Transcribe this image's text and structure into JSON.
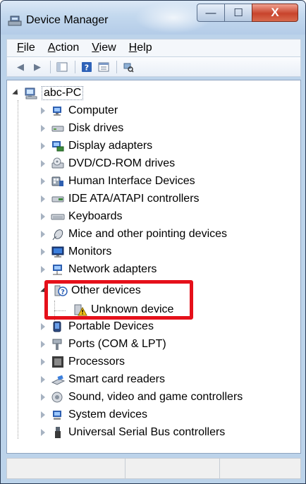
{
  "window": {
    "title": "Device Manager",
    "controls": {
      "minimize": "—",
      "maximize": "☐",
      "close": "X"
    }
  },
  "menu": {
    "items": [
      {
        "hotkey": "F",
        "rest": "ile"
      },
      {
        "hotkey": "A",
        "rest": "ction"
      },
      {
        "hotkey": "V",
        "rest": "iew"
      },
      {
        "hotkey": "H",
        "rest": "elp"
      }
    ]
  },
  "toolbar": {
    "back": "◀",
    "forward": "▶"
  },
  "tree": {
    "root": "abc-PC",
    "items": [
      {
        "label": "Computer",
        "icon": "computer-icon"
      },
      {
        "label": "Disk drives",
        "icon": "disk-drive-icon"
      },
      {
        "label": "Display adapters",
        "icon": "display-adapter-icon"
      },
      {
        "label": "DVD/CD-ROM drives",
        "icon": "dvd-drive-icon"
      },
      {
        "label": "Human Interface Devices",
        "icon": "hid-icon"
      },
      {
        "label": "IDE ATA/ATAPI controllers",
        "icon": "ide-controller-icon"
      },
      {
        "label": "Keyboards",
        "icon": "keyboard-icon"
      },
      {
        "label": "Mice and other pointing devices",
        "icon": "mouse-icon"
      },
      {
        "label": "Monitors",
        "icon": "monitor-icon"
      },
      {
        "label": "Network adapters",
        "icon": "network-adapter-icon"
      },
      {
        "label": "Other devices",
        "icon": "other-devices-icon",
        "children": [
          {
            "label": "Unknown device",
            "icon": "unknown-device-warning-icon"
          }
        ]
      },
      {
        "label": "Portable Devices",
        "icon": "portable-device-icon"
      },
      {
        "label": "Ports (COM & LPT)",
        "icon": "port-icon"
      },
      {
        "label": "Processors",
        "icon": "processor-icon"
      },
      {
        "label": "Smart card readers",
        "icon": "smart-card-icon"
      },
      {
        "label": "Sound, video and game controllers",
        "icon": "sound-icon"
      },
      {
        "label": "System devices",
        "icon": "system-device-icon"
      },
      {
        "label": "Universal Serial Bus controllers",
        "icon": "usb-icon"
      }
    ]
  },
  "colors": {
    "highlight": "#e5101a",
    "title_bar": "#c3d8ee"
  }
}
